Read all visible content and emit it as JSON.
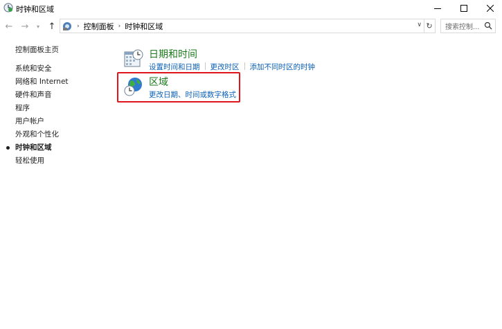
{
  "window": {
    "title": "时钟和区域"
  },
  "address": {
    "breadcrumb": [
      "控制面板",
      "时钟和区域"
    ],
    "search_placeholder": "搜索控制..."
  },
  "leftnav": {
    "home": "控制面板主页",
    "items": [
      "系统和安全",
      "网络和 Internet",
      "硬件和声音",
      "程序",
      "用户帐户",
      "外观和个性化",
      "时钟和区域",
      "轻松使用"
    ],
    "current_index": 6
  },
  "categories": {
    "datetime": {
      "title": "日期和时间",
      "links": [
        "设置时间和日期",
        "更改时区",
        "添加不同时区的时钟"
      ]
    },
    "region": {
      "title": "区域",
      "links": [
        "更改日期、时间或数字格式"
      ]
    }
  },
  "colors": {
    "category_title": "#1a7a1a",
    "link": "#0a5fb4",
    "highlight": "#e0141b"
  }
}
